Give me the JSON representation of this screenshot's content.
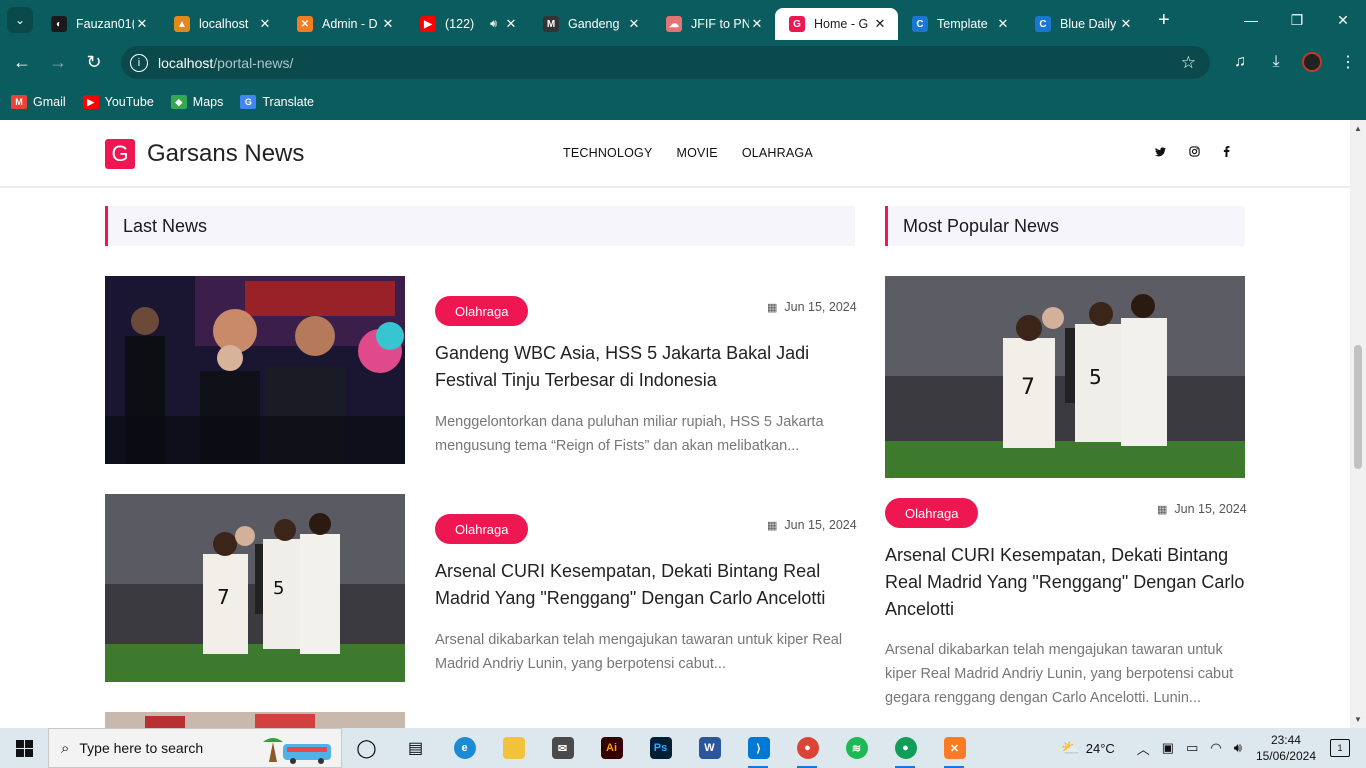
{
  "browser": {
    "tabs": [
      {
        "title": "Fauzan01(",
        "fav_color": "#1a1a1a",
        "fav_char": "◐",
        "active": false,
        "audio": false
      },
      {
        "title": "localhost",
        "fav_color": "#e08a1e",
        "fav_char": "▲",
        "active": false,
        "audio": false
      },
      {
        "title": "Admin - D",
        "fav_color": "#f57c20",
        "fav_char": "✕",
        "active": false,
        "audio": false
      },
      {
        "title": "(122)",
        "fav_color": "#ff0000",
        "fav_char": "▶",
        "active": false,
        "audio": true
      },
      {
        "title": "Gandeng",
        "fav_color": "#333333",
        "fav_char": "M",
        "active": false,
        "audio": false
      },
      {
        "title": "JFIF to PN",
        "fav_color": "#e57373",
        "fav_char": "☁",
        "active": false,
        "audio": false
      },
      {
        "title": "Home - G",
        "fav_color": "#ee1752",
        "fav_char": "G",
        "active": true,
        "audio": false
      },
      {
        "title": "Template",
        "fav_color": "#1976d2",
        "fav_char": "C",
        "active": false,
        "audio": false
      },
      {
        "title": "Blue Daily",
        "fav_color": "#1976d2",
        "fav_char": "C",
        "active": false,
        "audio": false
      }
    ],
    "address": {
      "host": "localhost",
      "path": "/portal-news/"
    },
    "bookmarks": [
      {
        "label": "Gmail",
        "color": "#ea4335",
        "char": "M"
      },
      {
        "label": "YouTube",
        "color": "#ff0000",
        "char": "▶"
      },
      {
        "label": "Maps",
        "color": "#34a853",
        "char": "◆"
      },
      {
        "label": "Translate",
        "color": "#4285f4",
        "char": "G"
      }
    ]
  },
  "site": {
    "logo_letter": "G",
    "logo_text": "Garsans News",
    "menu": [
      "TECHNOLOGY",
      "MOVIE",
      "OLAHRAGA"
    ],
    "social": [
      "twitter-icon",
      "instagram-icon",
      "facebook-icon"
    ],
    "accent": "#ee1752"
  },
  "last_news": {
    "title": "Last News",
    "items": [
      {
        "category": "Olahraga",
        "date": "Jun 15, 2024",
        "headline": "Gandeng WBC Asia, HSS 5 Jakarta Bakal Jadi Festival Tinju Terbesar di Indonesia",
        "excerpt": "Menggelontorkan dana puluhan miliar rupiah, HSS 5 Jakarta mengusung tema “Reign of Fists” dan akan melibatkan..."
      },
      {
        "category": "Olahraga",
        "date": "Jun 15, 2024",
        "headline": "Arsenal CURI Kesempatan, Dekati Bintang Real Madrid Yang \"Renggang\" Dengan Carlo Ancelotti",
        "excerpt": "Arsenal dikabarkan telah mengajukan tawaran untuk kiper Real Madrid Andriy Lunin, yang berpotensi cabut..."
      }
    ]
  },
  "popular_news": {
    "title": "Most Popular News",
    "item": {
      "category": "Olahraga",
      "date": "Jun 15, 2024",
      "headline": "Arsenal CURI Kesempatan, Dekati Bintang Real Madrid Yang \"Renggang\" Dengan Carlo Ancelotti",
      "excerpt": "Arsenal dikabarkan telah mengajukan tawaran untuk kiper Real Madrid Andriy Lunin, yang berpotensi cabut gegara renggang dengan Carlo Ancelotti. Lunin..."
    }
  },
  "taskbar": {
    "search_placeholder": "Type here to search",
    "weather": "24°C",
    "weather_badge": "1",
    "time": "23:44",
    "date": "15/06/2024",
    "notif_count": "1"
  }
}
